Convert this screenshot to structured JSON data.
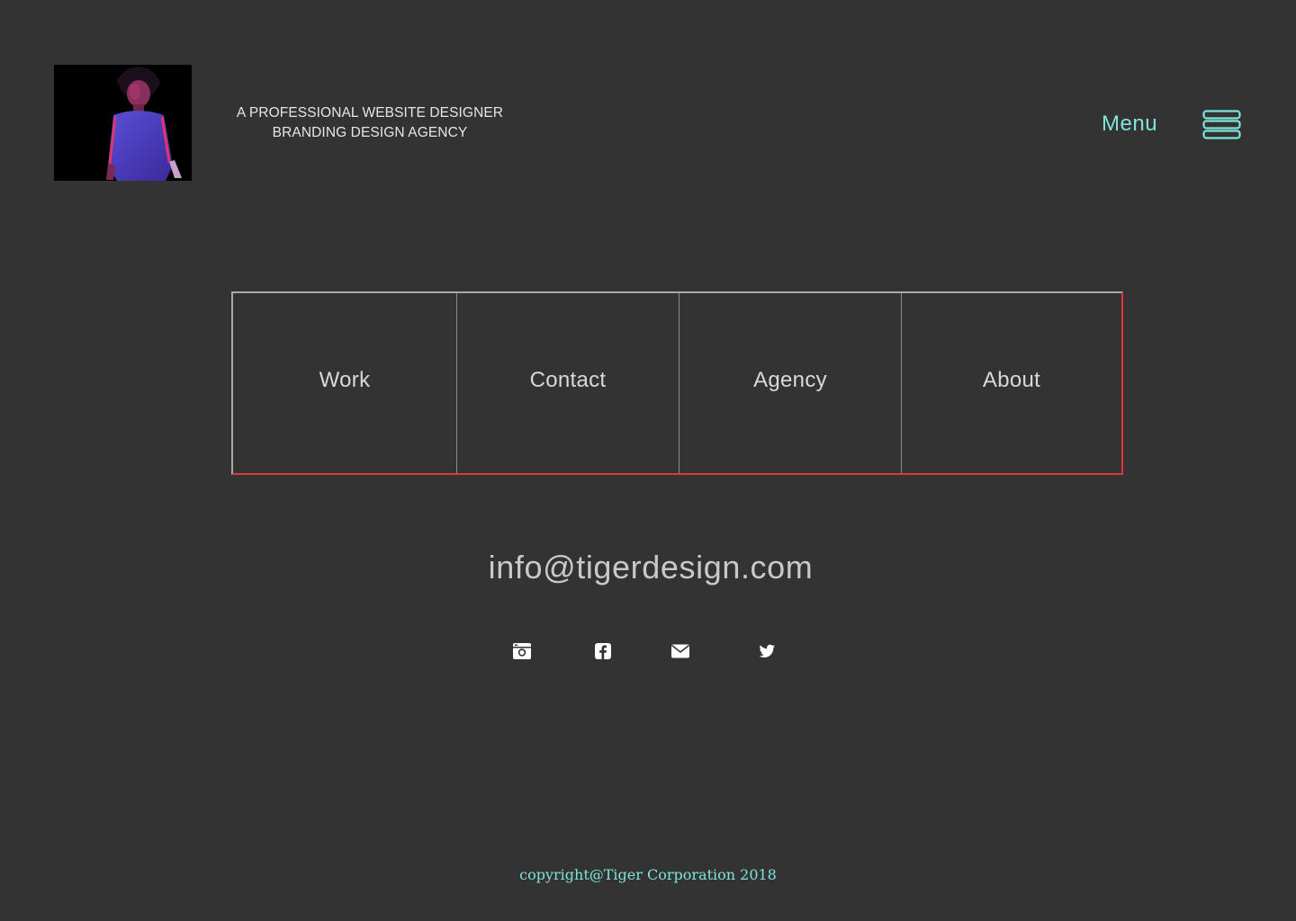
{
  "header": {
    "tagline_line1": "A PROFESSIONAL WEBSITE DESIGNER",
    "tagline_line2": "BRANDING DESIGN AGENCY",
    "menu_label": "Menu"
  },
  "nav": {
    "items": [
      {
        "label": "Work"
      },
      {
        "label": "Contact"
      },
      {
        "label": "Agency"
      },
      {
        "label": "About"
      }
    ]
  },
  "contact": {
    "email": "info@tigerdesign.com"
  },
  "social": [
    {
      "icon": "instagram-icon"
    },
    {
      "icon": "facebook-icon"
    },
    {
      "icon": "mail-icon"
    },
    {
      "icon": "twitter-icon"
    }
  ],
  "footer": {
    "copyright": "copyright@Tiger Corporation 2018"
  },
  "colors": {
    "background": "#333333",
    "accent_teal": "#7fe5dc",
    "nav_border_red": "#e0353b",
    "nav_border_grey": "#a9a9a9"
  }
}
